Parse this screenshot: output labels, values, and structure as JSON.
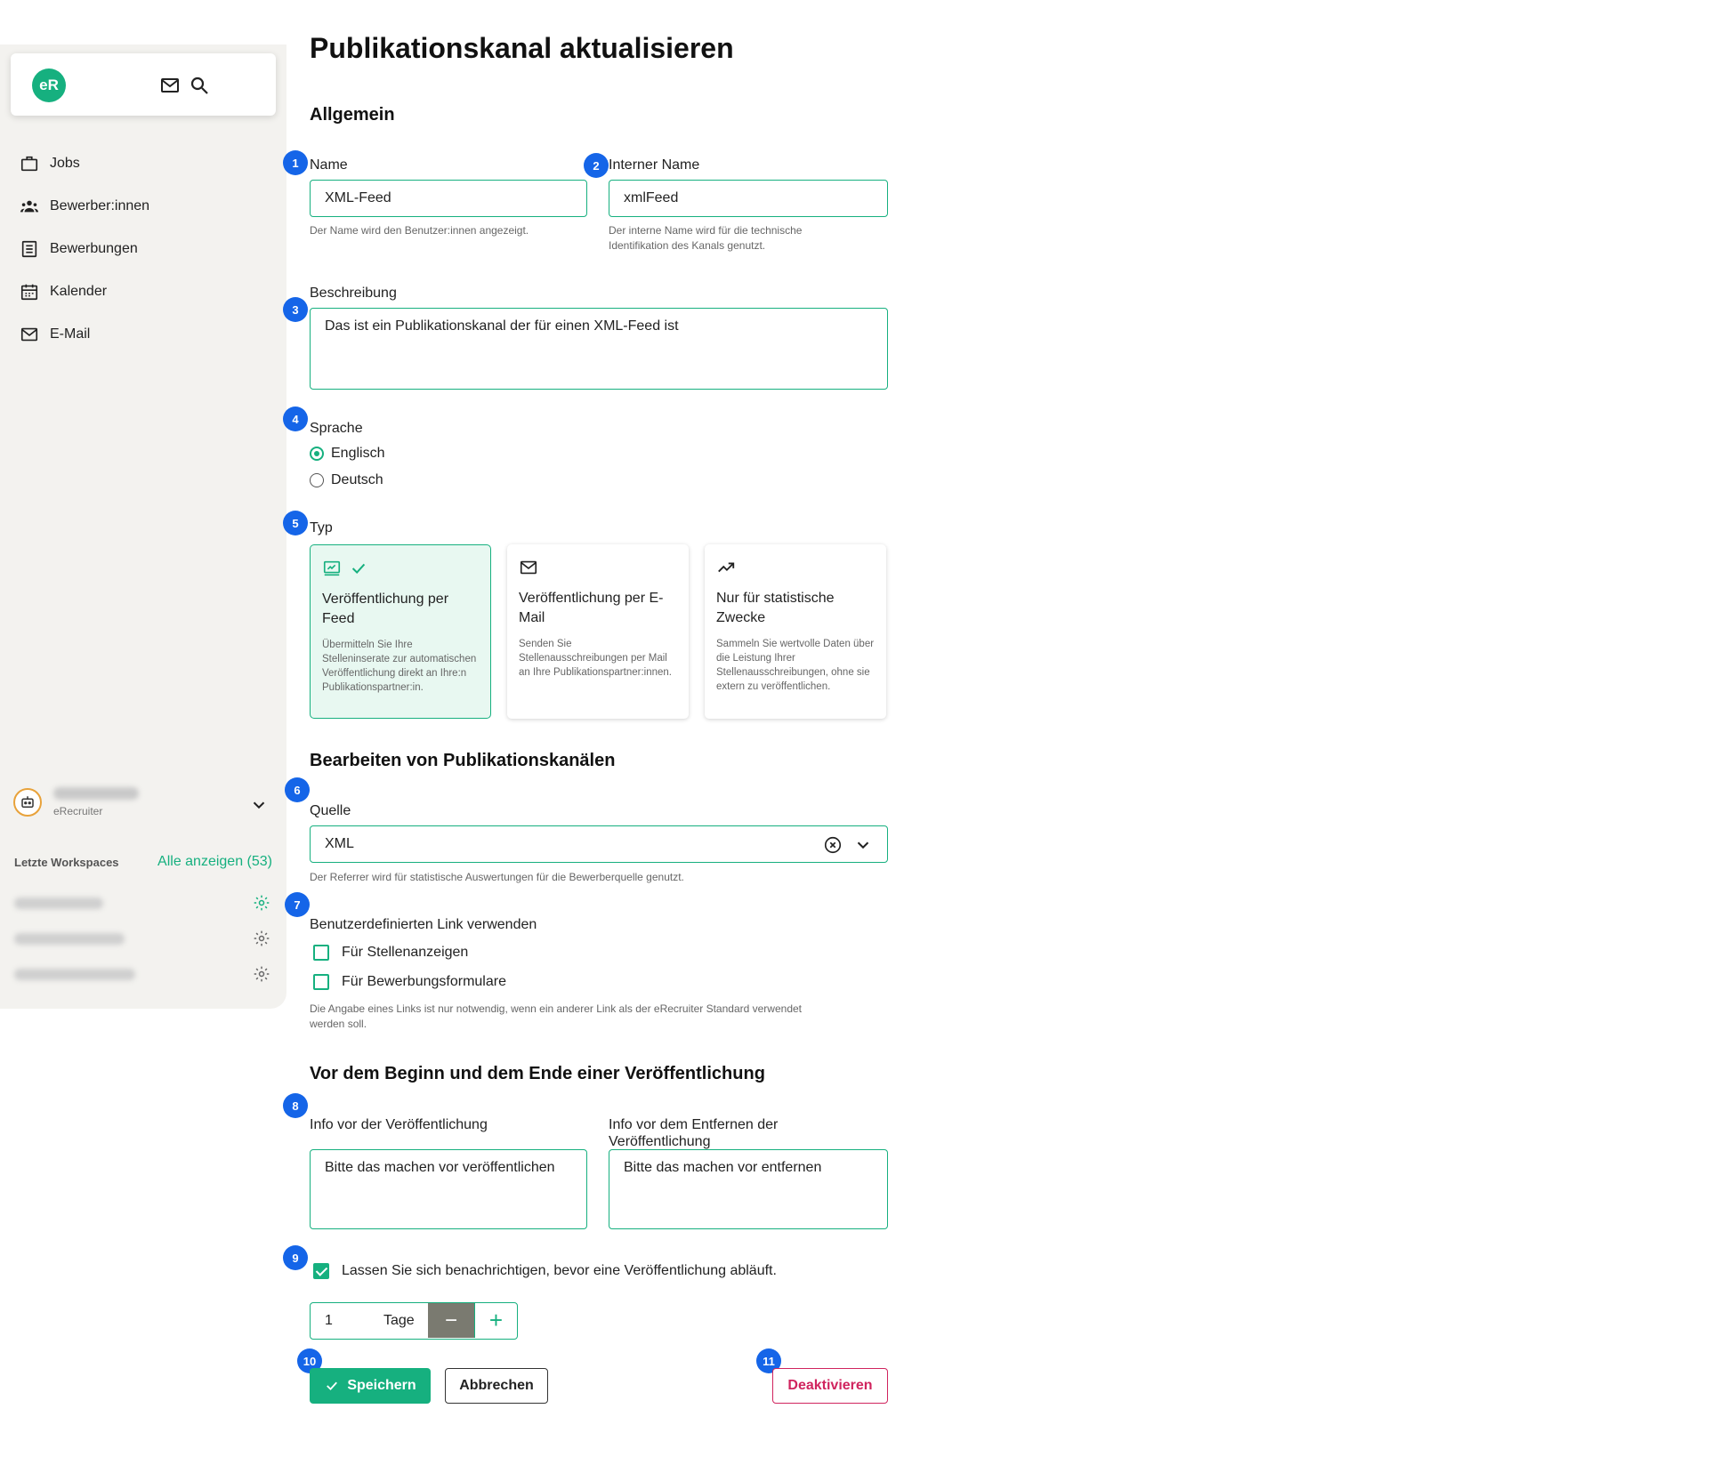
{
  "sidebar": {
    "logo": "eR",
    "icons": {
      "mail": "mail-icon",
      "search": "search-icon"
    },
    "nav": [
      {
        "label": "Jobs",
        "icon": "briefcase-icon"
      },
      {
        "label": "Bewerber:innen",
        "icon": "people-icon"
      },
      {
        "label": "Bewerbungen",
        "icon": "document-list-icon"
      },
      {
        "label": "Kalender",
        "icon": "calendar-icon"
      },
      {
        "label": "E-Mail",
        "icon": "mail-icon"
      }
    ],
    "account": {
      "subtitle": "eRecruiter"
    },
    "workspaces": {
      "heading": "Letzte Workspaces",
      "show_all": "Alle anzeigen (53)"
    }
  },
  "page": {
    "title": "Publikationskanal aktualisieren",
    "section_general": "Allgemein",
    "name": {
      "label": "Name",
      "value": "XML-Feed",
      "help": "Der Name wird den Benutzer:innen angezeigt."
    },
    "internal_name": {
      "label": "Interner Name",
      "value": "xmlFeed",
      "help_line1": "Der interne Name wird für die technische",
      "help_line2": "Identifikation des Kanals genutzt."
    },
    "description": {
      "label": "Beschreibung",
      "value": "Das ist ein Publikationskanal der für einen XML-Feed ist"
    },
    "language": {
      "label": "Sprache",
      "options": [
        "Englisch",
        "Deutsch"
      ],
      "selected": "Englisch"
    },
    "type": {
      "label": "Typ",
      "cards": [
        {
          "title_line1": "Veröffentlichung per",
          "title_line2": "Feed",
          "desc": "Übermitteln Sie Ihre Stelleninserate zur automatischen Veröffentlichung direkt an Ihre:n Publikationspartner:in.",
          "selected": true
        },
        {
          "title_line1": "Veröffentlichung per E-",
          "title_line2": "Mail",
          "desc": "Senden Sie Stellenausschreibungen per Mail an Ihre Publikationspartner:innen.",
          "selected": false
        },
        {
          "title_line1": "Nur für statistische",
          "title_line2": "Zwecke",
          "desc": "Sammeln Sie wertvolle Daten über die Leistung Ihrer Stellenausschreibungen, ohne sie extern zu veröffentlichen.",
          "selected": false
        }
      ]
    },
    "section_edit": "Bearbeiten von Publikationskanälen",
    "source": {
      "label": "Quelle",
      "value": "XML",
      "help": "Der Referrer wird für statistische Auswertungen für die Bewerberquelle genutzt."
    },
    "custom_link": {
      "label": "Benutzerdefinierten Link verwenden",
      "options": [
        "Für Stellenanzeigen",
        "Für Bewerbungsformulare"
      ],
      "help_line1": "Die Angabe eines Links ist nur notwendig, wenn ein anderer Link als der eRecruiter Standard verwendet",
      "help_line2": "werden soll."
    },
    "section_timing": "Vor dem Beginn und dem Ende einer Veröffentlichung",
    "info_before": {
      "label": "Info vor der Veröffentlichung",
      "value": "Bitte das machen vor veröffentlichen"
    },
    "info_remove": {
      "label_line1": "Info vor dem Entfernen der",
      "label_line2": "Veröffentlichung",
      "value": "Bitte das machen vor entfernen"
    },
    "notify": {
      "label": "Lassen Sie sich benachrichtigen, bevor eine Veröffentlichung abläuft.",
      "checked": true
    },
    "days": {
      "value": "1",
      "unit": "Tage",
      "minus": "−",
      "plus": "+"
    },
    "buttons": {
      "save": "Speichern",
      "cancel": "Abbrechen",
      "deactivate": "Deaktivieren"
    },
    "badges": [
      "1",
      "2",
      "3",
      "4",
      "5",
      "6",
      "7",
      "8",
      "9",
      "10",
      "11"
    ]
  },
  "colors": {
    "accent": "#16b07f",
    "badge": "#1565e8",
    "danger": "#d0245e",
    "sidebar_bg": "#f3f2ef"
  }
}
